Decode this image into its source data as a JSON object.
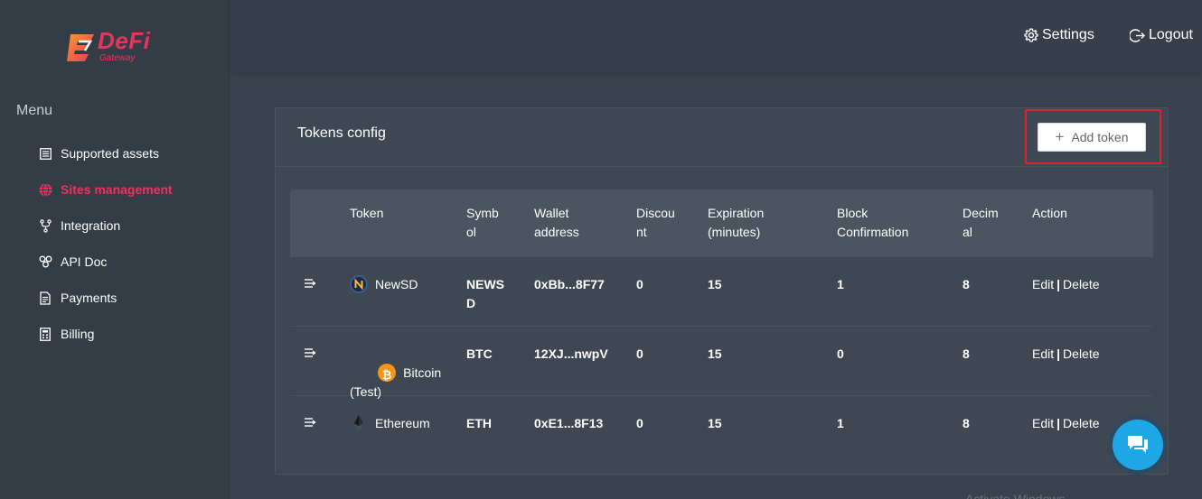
{
  "brand": {
    "name": "DeFi",
    "sub": "Gateway",
    "colors": {
      "brand": "#e8355e",
      "logo_gradient_start": "#f79a2a",
      "accent": "#1ea7e6",
      "highlight_border": "#e01e2e"
    }
  },
  "sidebar": {
    "menu_title": "Menu",
    "items": [
      {
        "label": "Supported assets",
        "icon": "list-icon",
        "active": false
      },
      {
        "label": "Sites management",
        "icon": "globe-icon",
        "active": true
      },
      {
        "label": "Integration",
        "icon": "fork-icon",
        "active": false
      },
      {
        "label": "API Doc",
        "icon": "api-icon",
        "active": false
      },
      {
        "label": "Payments",
        "icon": "document-icon",
        "active": false
      },
      {
        "label": "Billing",
        "icon": "calculator-icon",
        "active": false
      }
    ]
  },
  "header": {
    "settings": "Settings",
    "logout": "Logout"
  },
  "card": {
    "title": "Tokens config",
    "add_button": "Add token"
  },
  "table": {
    "headers": [
      "Token",
      "Symb\nol",
      "Wallet\naddress",
      "Discou\nnt",
      "Expiration\n(minutes)",
      "Block\nConfirmation",
      "Decim\nal",
      "Action"
    ],
    "rows": [
      {
        "token": "NewSD",
        "icon": "newsd-icon",
        "symbol": "NEWS\nD",
        "wallet": "0xBb...8F77",
        "discount": "0",
        "expiration": "15",
        "confirmation": "1",
        "decimal": "8",
        "edit": "Edit",
        "sep": "|",
        "delete": "Delete"
      },
      {
        "token": "Bitcoin\n(Test)",
        "icon": "bitcoin-icon",
        "symbol": "BTC",
        "wallet": "12XJ...nwpV",
        "discount": "0",
        "expiration": "15",
        "confirmation": "0",
        "decimal": "8",
        "edit": "Edit",
        "sep": "|",
        "delete": "Delete"
      },
      {
        "token": "Ethereum",
        "icon": "ethereum-icon",
        "symbol": "ETH",
        "wallet": "0xE1...8F13",
        "discount": "0",
        "expiration": "15",
        "confirmation": "1",
        "decimal": "8",
        "edit": "Edit",
        "sep": "|",
        "delete": "Delete"
      }
    ]
  },
  "footer_ghost": "Activate Windows"
}
